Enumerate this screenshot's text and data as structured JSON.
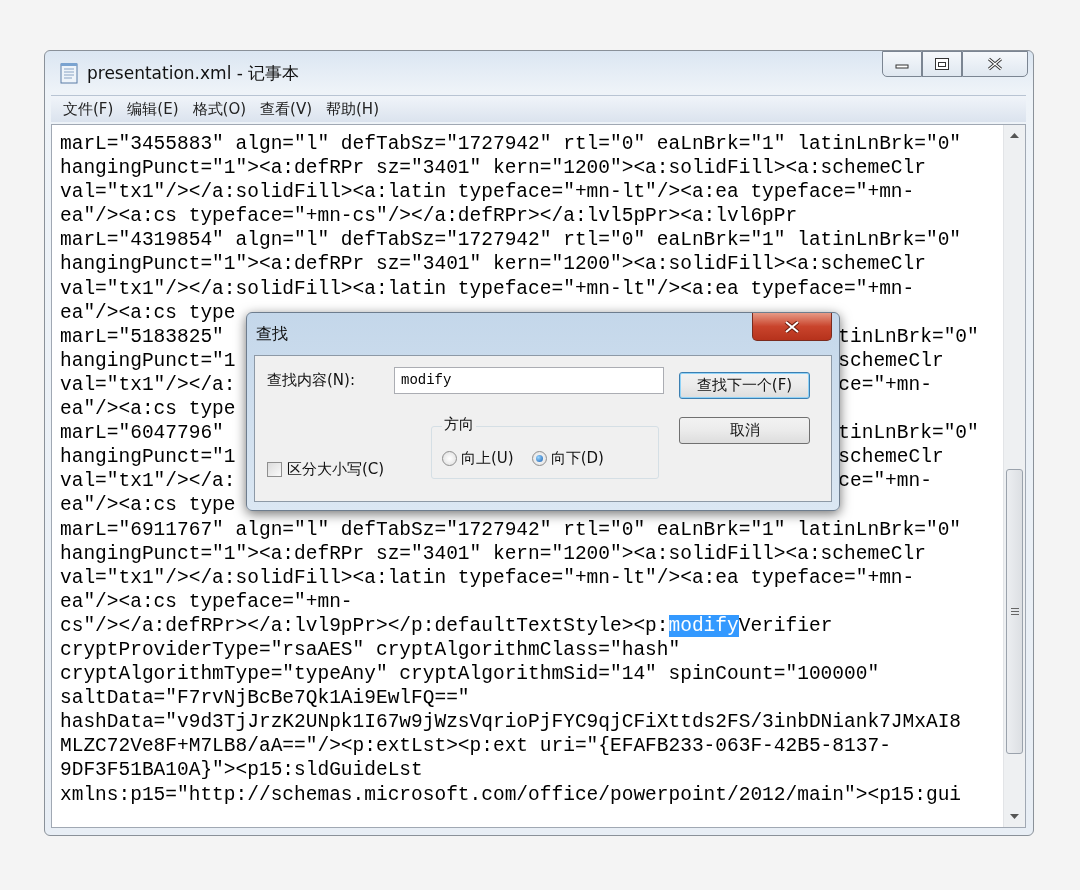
{
  "window": {
    "title": "presentation.xml - 记事本"
  },
  "menu": [
    "文件(F)",
    "编辑(E)",
    "格式(O)",
    "查看(V)",
    "帮助(H)"
  ],
  "editor": {
    "lines": [
      {
        "text": "marL=\"3455883\" algn=\"l\" defTabSz=\"1727942\" rtl=\"0\" eaLnBrk=\"1\" latinLnBrk=\"0\""
      },
      {
        "text": "hangingPunct=\"1\"><a:defRPr sz=\"3401\" kern=\"1200\"><a:solidFill><a:schemeClr"
      },
      {
        "text": "val=\"tx1\"/></a:solidFill><a:latin typeface=\"+mn-lt\"/><a:ea typeface=\"+mn-"
      },
      {
        "text": "ea\"/><a:cs typeface=\"+mn-cs\"/></a:defRPr></a:lvl5pPr><a:lvl6pPr"
      },
      {
        "text": "marL=\"4319854\" algn=\"l\" defTabSz=\"1727942\" rtl=\"0\" eaLnBrk=\"1\" latinLnBrk=\"0\""
      },
      {
        "text": "hangingPunct=\"1\"><a:defRPr sz=\"3401\" kern=\"1200\"><a:solidFill><a:schemeClr"
      },
      {
        "text": "val=\"tx1\"/></a:solidFill><a:latin typeface=\"+mn-lt\"/><a:ea typeface=\"+mn-"
      },
      {
        "left": "ea\"/><a:cs type"
      },
      {
        "left": "marL=\"5183825\"",
        "right": "tinLnBrk=\"0\""
      },
      {
        "left": "hangingPunct=\"1",
        "right": "schemeClr"
      },
      {
        "left": "val=\"tx1\"/></a:",
        "right": "ce=\"+mn-"
      },
      {
        "left": "ea\"/><a:cs type"
      },
      {
        "left": "marL=\"6047796\"",
        "right": "tinLnBrk=\"0\""
      },
      {
        "left": "hangingPunct=\"1",
        "right": "schemeClr"
      },
      {
        "left": "val=\"tx1\"/></a:",
        "right": "ce=\"+mn-"
      },
      {
        "left": "ea\"/><a:cs type"
      },
      {
        "text": "marL=\"6911767\" algn=\"l\" defTabSz=\"1727942\" rtl=\"0\" eaLnBrk=\"1\" latinLnBrk=\"0\""
      },
      {
        "text": "hangingPunct=\"1\"><a:defRPr sz=\"3401\" kern=\"1200\"><a:solidFill><a:schemeClr"
      },
      {
        "text": "val=\"tx1\"/></a:solidFill><a:latin typeface=\"+mn-lt\"/><a:ea typeface=\"+mn-"
      },
      {
        "text": "ea\"/><a:cs typeface=\"+mn-"
      },
      {
        "segments": [
          {
            "text": "cs\"/></a:defRPr></a:lvl9pPr></p:defaultTextStyle><p:",
            "highlighted": false
          },
          {
            "text": "modify",
            "highlighted": true
          },
          {
            "text": "Verifier",
            "highlighted": false
          }
        ]
      },
      {
        "text": "cryptProviderType=\"rsaAES\" cryptAlgorithmClass=\"hash\""
      },
      {
        "text": "cryptAlgorithmType=\"typeAny\" cryptAlgorithmSid=\"14\" spinCount=\"100000\""
      },
      {
        "text": "saltData=\"F7rvNjBcBe7Qk1Ai9EwlFQ==\""
      },
      {
        "text": "hashData=\"v9d3TjJrzK2UNpk1I67w9jWzsVqrioPjFYC9qjCFiXttds2FS/3inbDNiank7JMxAI8"
      },
      {
        "text": "MLZC72Ve8F+M7LB8/aA==\"/><p:extLst><p:ext uri=\"{EFAFB233-063F-42B5-8137-"
      },
      {
        "text": "9DF3F51BA10A}\"><p15:sldGuideLst"
      },
      {
        "text": "xmlns:p15=\"http://schemas.microsoft.com/office/powerpoint/2012/main\"><p15:gui"
      }
    ]
  },
  "find_dialog": {
    "title": "查找",
    "find_label": "查找内容(N):",
    "find_value": "modify",
    "find_next_button": "查找下一个(F)",
    "cancel_button": "取消",
    "match_case": {
      "label": "区分大小写(C)",
      "checked": false
    },
    "direction": {
      "label": "方向",
      "options": [
        {
          "label": "向上(U)",
          "selected": false
        },
        {
          "label": "向下(D)",
          "selected": true
        }
      ]
    }
  }
}
